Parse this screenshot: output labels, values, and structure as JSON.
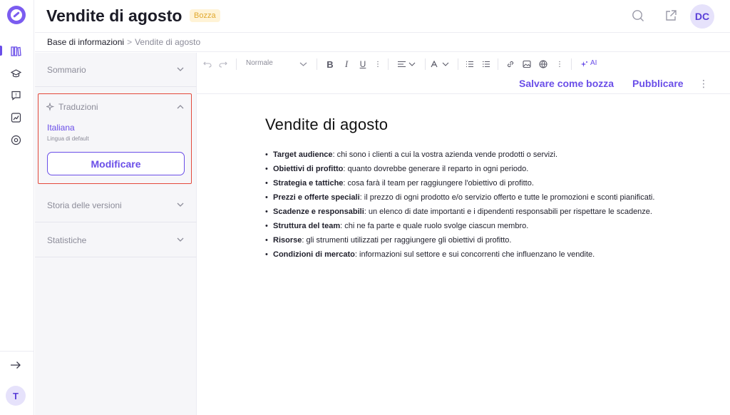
{
  "header": {
    "title": "Vendite di agosto",
    "status_badge": "Bozza",
    "avatar_initials": "DC"
  },
  "breadcrumb": {
    "root": "Base di informazioni",
    "separator": ">",
    "current": "Vendite di agosto"
  },
  "rail": {
    "bottom_avatar": "T",
    "items": [
      "library-icon",
      "graduation-cap-icon",
      "chat-question-icon",
      "analytics-icon",
      "settings-icon"
    ]
  },
  "sidebar": {
    "sections": {
      "summary": "Sommario",
      "translations": "Traduzioni",
      "version_history": "Storia delle versioni",
      "statistics": "Statistiche"
    },
    "translation": {
      "language": "Italiana",
      "default_label": "Lingua di default",
      "edit_button": "Modificare"
    }
  },
  "toolbar": {
    "text_style": "Normale",
    "ai_label": "AI",
    "save_draft": "Salvare come bozza",
    "publish": "Pubblicare"
  },
  "document": {
    "heading": "Vendite di agosto",
    "items": [
      {
        "term": "Target audience",
        "text": ": chi sono i clienti a cui la vostra azienda vende prodotti o servizi."
      },
      {
        "term": "Obiettivi di profitto",
        "text": ": quanto dovrebbe generare il reparto in ogni periodo."
      },
      {
        "term": "Strategia e tattiche",
        "text": ": cosa farà il team per raggiungere l'obiettivo di profitto."
      },
      {
        "term": "Prezzi e offerte speciali",
        "text": ": il prezzo di ogni prodotto e/o servizio offerto e tutte le promozioni e sconti pianificati."
      },
      {
        "term": "Scadenze e responsabili",
        "text": ": un elenco di date importanti e i dipendenti responsabili per rispettare le scadenze."
      },
      {
        "term": "Struttura del team",
        "text": ": chi ne fa parte e quale ruolo svolge ciascun membro."
      },
      {
        "term": "Risorse",
        "text": ": gli strumenti utilizzati per raggiungere gli obiettivi di profitto."
      },
      {
        "term": "Condizioni di mercato",
        "text": ": informazioni sul settore e sui concorrenti che influenzano le vendite."
      }
    ]
  },
  "colors": {
    "accent": "#6a4ee8",
    "highlight_border": "#e4493b",
    "badge_text": "#e0a82e"
  }
}
